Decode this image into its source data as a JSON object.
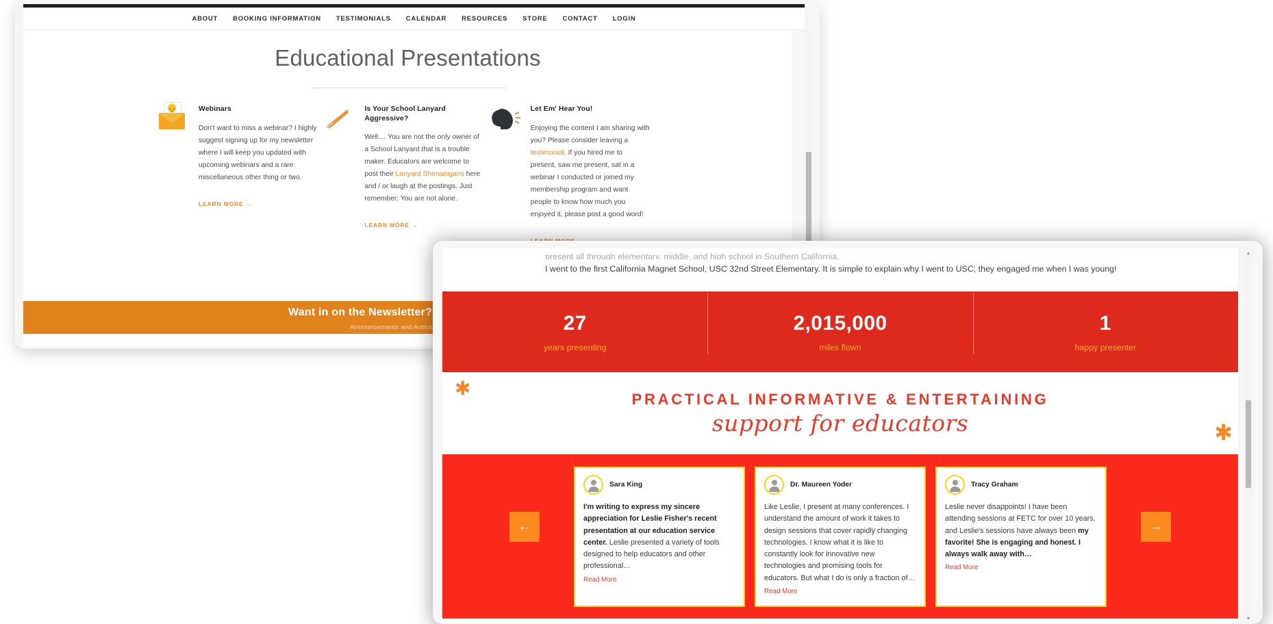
{
  "back_window": {
    "nav": {
      "items": [
        {
          "label": "ABOUT"
        },
        {
          "label": "BOOKING INFORMATION"
        },
        {
          "label": "TESTIMONIALS"
        },
        {
          "label": "CALENDAR"
        },
        {
          "label": "RESOURCES"
        },
        {
          "label": "STORE"
        },
        {
          "label": "CONTACT"
        },
        {
          "label": "LOGIN"
        }
      ]
    },
    "page_title": "Educational Presentations",
    "columns": [
      {
        "icon": "envelope-icon",
        "heading": "Webinars",
        "body_before": "Don't want to miss a webinar? I highly suggest signing up for my newsletter where I will keep you updated with upcoming webinars and a rare miscellaneous other thing or two.",
        "link_text": "",
        "body_after": "",
        "cta": "LEARN MORE"
      },
      {
        "icon": "pencil-icon",
        "heading": "Is Your School Lanyard Aggressive?",
        "body_before": "Well.... You are not the only owner of a School Lanyard that is a trouble maker. Educators are welcome to post their ",
        "link_text": "Lanyard Shenanigans",
        "body_after": " here and / or laugh at the postings. Just remember: You are not alone.",
        "cta": "LEARN MORE"
      },
      {
        "icon": "speaking-head-icon",
        "heading": "Let Em' Hear You!",
        "body_before": "Enjoying the content I am sharing with you? Please consider leaving a ",
        "link_text": "testimonial",
        "body_after": ". If you hired me to present, saw me present, sat in a webinar I conducted or joined my membership program and want people to know how much you enjoyed it, please post a good word!",
        "cta": "LEARN MORE"
      }
    ],
    "newsletter": {
      "title": "Want in on the Newsletter?",
      "subtitle": "Announcements and Antics",
      "button_icon": "paper-plane-icon"
    },
    "cta_arrow": "→"
  },
  "front_window": {
    "intro": {
      "clipped_line": "present all through elementary, middle, and high school in Southern California.",
      "paragraph": "I went to the first California Magnet School, USC 32nd Street Elementary. It is simple to explain why I went to USC; they engaged me when I was young!"
    },
    "stats": [
      {
        "value": "27",
        "label": "years presenting"
      },
      {
        "value": "2,015,000",
        "label": "miles flown"
      },
      {
        "value": "1",
        "label": "happy presenter"
      }
    ],
    "tagline": {
      "line1": "PRACTICAL INFORMATIVE & ENTERTAINING",
      "line2": "support for educators",
      "decor_icon": "starburst-icon"
    },
    "testimonials": {
      "prev_icon": "←",
      "next_icon": "→",
      "cards": [
        {
          "avatar": "user-avatar-icon",
          "name": "Sara King",
          "bold_text": "I'm writing to express my sincere appreciation for Leslie Fisher's recent presentation at our education service center.",
          "rest_text": " Leslie presented a variety of tools designed to help educators and other professional…",
          "read_more": "Read More"
        },
        {
          "avatar": "user-avatar-icon",
          "name": "Dr. Maureen Yoder",
          "bold_text": "",
          "rest_text": "Like Leslie, I present at many conferences.  I understand the amount of work it takes to design sessions that cover rapidly changing technologies. I know what it is like to constantly look for innovative new technologies and promising tools for educators.  But what I do is only a fraction of…",
          "read_more": "Read More"
        },
        {
          "avatar": "user-avatar-icon",
          "name": "Tracy Graham",
          "bold_text": "",
          "rest_text": "Leslie never disappoints! I have been attending sessions at FETC for over 10 years, and Leslie's sessions have always been ",
          "bold_tail": "my favorite! She is engaging and honest. I always walk away with…",
          "read_more": "Read More"
        }
      ]
    },
    "scrollbar": {
      "up_icon": "▲",
      "down_icon": "▼"
    }
  },
  "colors": {
    "orange": "#f0882a",
    "newsletter_bg": "#e1821d",
    "stats_bg": "#de2a1c",
    "stats_label": "#f5b120",
    "testimonial_bg": "#fc2a1c",
    "card_border": "#ffd21f",
    "nav_button": "#fc8a1e",
    "tagline_red": "#e8392a"
  }
}
